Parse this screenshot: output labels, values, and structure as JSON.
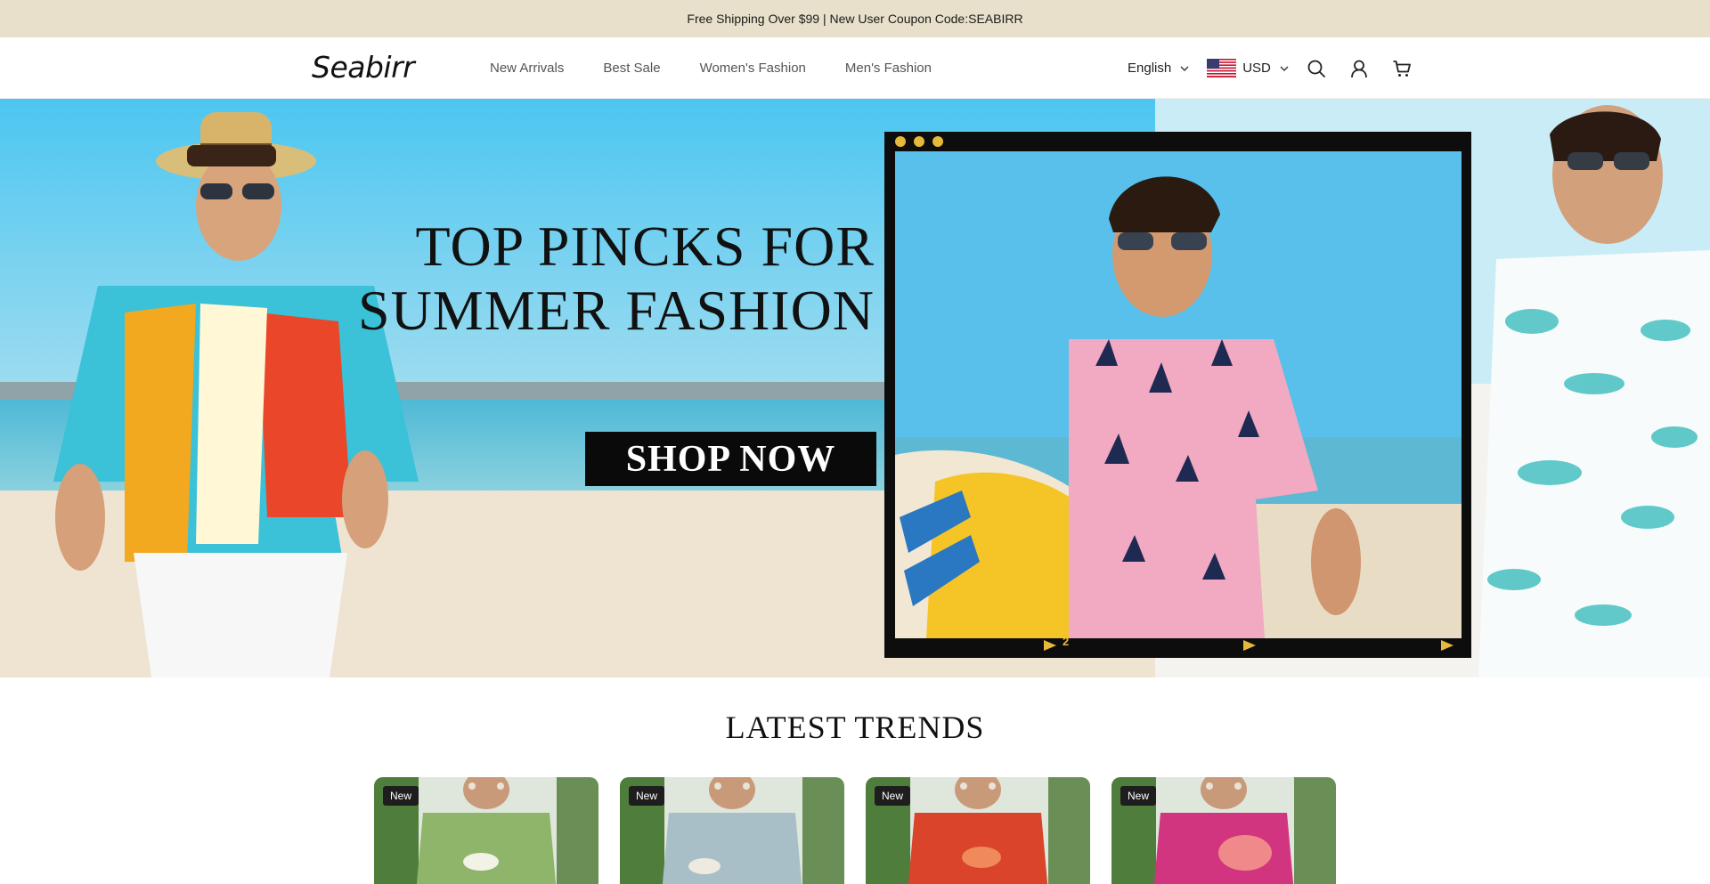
{
  "announcement": "Free Shipping Over $99 | New User Coupon Code:SEABIRR",
  "header": {
    "logo": "Seabirr",
    "nav": [
      "New Arrivals",
      "Best Sale",
      "Women's Fashion",
      "Men's Fashion"
    ],
    "language": "English",
    "currency": "USD",
    "icons": [
      "search-icon",
      "account-icon",
      "cart-icon"
    ]
  },
  "hero": {
    "title_line1": "TOP PINCKS FOR",
    "title_line2": "SUMMER FASHION",
    "cta": "SHOP NOW",
    "frame_caption": "2"
  },
  "trends": {
    "title": "LATEST TRENDS",
    "products": [
      {
        "badge": "New",
        "color": "#8fb56a"
      },
      {
        "badge": "New",
        "color": "#a9bfc8"
      },
      {
        "badge": "New",
        "color": "#d9442a"
      },
      {
        "badge": "New",
        "color": "#d2357f"
      }
    ]
  },
  "colors": {
    "announcement_bg": "#e8e0cb",
    "sky": "#5ccbee",
    "sand": "#efe4d2"
  }
}
